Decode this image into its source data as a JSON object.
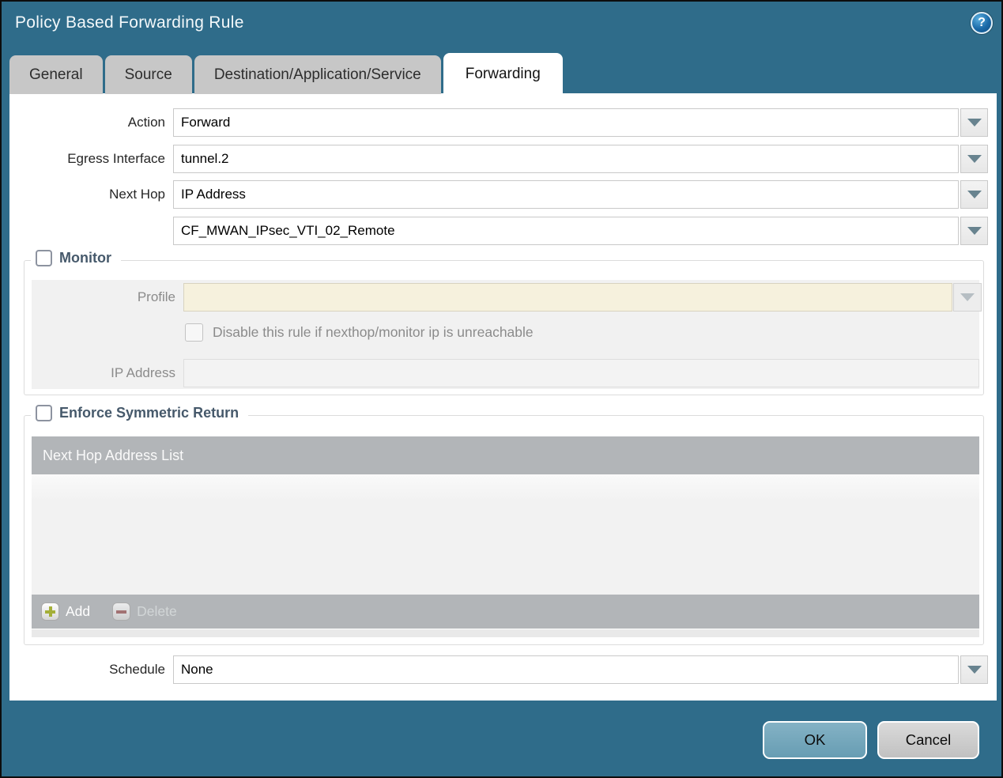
{
  "window": {
    "title": "Policy Based Forwarding Rule"
  },
  "icons": {
    "help": "?"
  },
  "tabs": [
    {
      "label": "General",
      "active": false
    },
    {
      "label": "Source",
      "active": false
    },
    {
      "label": "Destination/Application/Service",
      "active": false
    },
    {
      "label": "Forwarding",
      "active": true
    }
  ],
  "form": {
    "action": {
      "label": "Action",
      "value": "Forward"
    },
    "egress_interface": {
      "label": "Egress Interface",
      "value": "tunnel.2"
    },
    "next_hop": {
      "label": "Next Hop",
      "value": "IP Address"
    },
    "next_hop_address": {
      "value": "CF_MWAN_IPsec_VTI_02_Remote"
    },
    "schedule": {
      "label": "Schedule",
      "value": "None"
    }
  },
  "monitor": {
    "legend": "Monitor",
    "checked": false,
    "profile": {
      "label": "Profile",
      "value": ""
    },
    "disable_rule": {
      "label": "Disable this rule if nexthop/monitor ip is unreachable",
      "checked": false
    },
    "ip_address": {
      "label": "IP Address",
      "value": ""
    }
  },
  "enforce": {
    "legend": "Enforce Symmetric Return",
    "checked": false,
    "table": {
      "header": "Next Hop Address List",
      "rows": []
    },
    "toolbar": {
      "add_label": "Add",
      "delete_label": "Delete"
    }
  },
  "buttons": {
    "ok": "OK",
    "cancel": "Cancel"
  },
  "colors": {
    "background": "#2f6c8a",
    "panel": "#ffffff",
    "tab_inactive": "#c7c7c7",
    "accent_ok": "#74a7bc",
    "disabled_field": "#f6f1dd",
    "table_header": "#b2b5b8",
    "legend_text": "#46596b"
  }
}
